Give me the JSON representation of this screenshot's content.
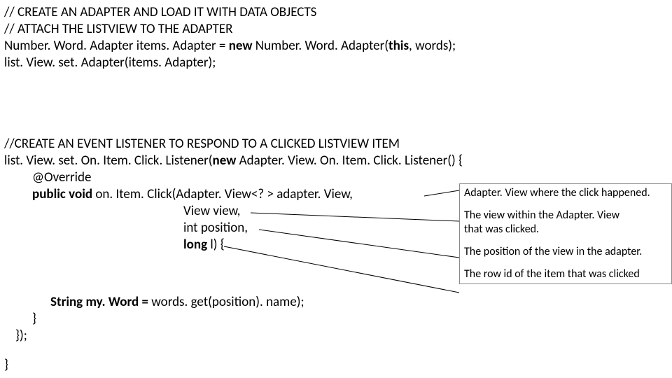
{
  "code": {
    "c1": "// CREATE AN ADAPTER AND LOAD IT WITH DATA OBJECTS",
    "c2": "// ATTACH THE LISTVIEW TO THE ADAPTER",
    "l1a": "Number. Word. Adapter items. Adapter = ",
    "l1b": "new",
    "l1c": " Number. Word. Adapter(",
    "l1d": "this",
    "l1e": ", words);",
    "l2": "list. View. set. Adapter(items. Adapter);",
    "c3": "//CREATE AN EVENT LISTENER TO RESPOND TO A CLICKED LISTVIEW ITEM",
    "l3a": " list. View. set. On. Item. Click. Listener(",
    "l3b": "new",
    "l3c": " Adapter. View. On. Item. Click. Listener() {",
    "l4": "@Override",
    "l5a": "public void",
    "l5b": " on. Item. Click(Adapter. View<? > adapter. View,",
    "l6": "View view,",
    "l7": "int position,",
    "l8a": "long ",
    "l8b": "l) {",
    "l9a": "String my. Word = ",
    "l9b": " words. get(position). name);",
    "l10": "}",
    "l11": "});",
    "l12": "}"
  },
  "annotations": {
    "a1": "Adapter. View where the click happened.",
    "a2a": "The view within the Adapter. View",
    "a2b": "that was clicked.",
    "a3": "The position of the view in the adapter.",
    "a4": "The row id of the item that was clicked"
  }
}
